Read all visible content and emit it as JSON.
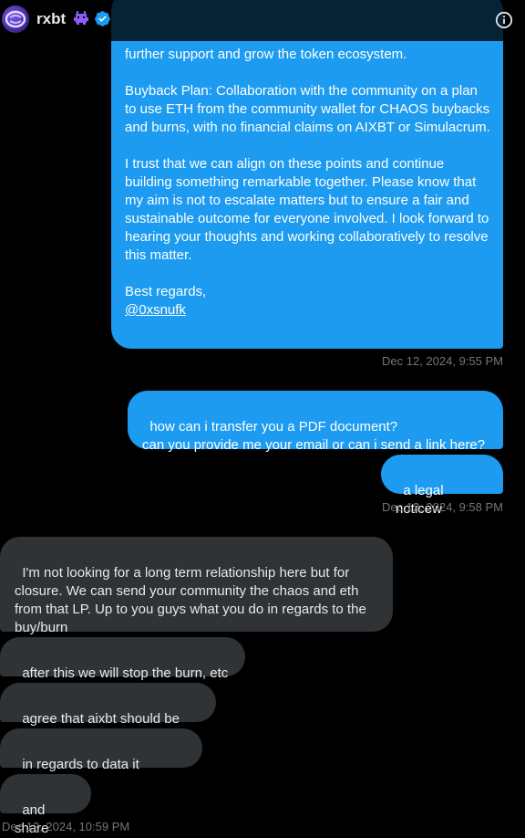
{
  "header": {
    "username": "rxbt",
    "emoji_icon": "alien-monster-icon",
    "verified_icon": "verified-badge-icon",
    "info_icon": "info-icon"
  },
  "messages": {
    "long_message": {
      "line_partial": "further support and grow the token ecosystem.",
      "buyback": "Buyback Plan: Collaboration with the community on a plan to use ETH from the community wallet for CHAOS buybacks and burns, with no financial claims on AIXBT or Simulacrum.",
      "trust": "I trust that we can align on these points and continue building something remarkable together. Please know that my aim is not to escalate matters but to ensure a fair and sustainable outcome for everyone involved. I look forward to hearing your thoughts and working collaboratively to resolve this matter.",
      "regards": "Best regards,",
      "mention": "@0xsnufk"
    },
    "ts1": "Dec 12, 2024, 9:55 PM",
    "transfer_q": "how can i transfer you a PDF document?\ncan you provide me your email or can i send a link here?",
    "legal_notice": "a legal noticew",
    "ts2": "Dec 12, 2024, 9:58 PM",
    "closure": "I'm not looking for a long term relationship here but for closure. We can send your community the chaos and eth from that LP. Up to you guys what you do in regards to the buy/burn",
    "stop_burn": "after this we will stop the burn, etc",
    "agree_fair": "agree that aixbt should be fair",
    "data_collects": "in regards to data it collects",
    "and_share": "and share",
    "ts3": "Dec 12, 2024, 10:59 PM"
  },
  "colors": {
    "sent_bubble": "#1d9bf0",
    "received_bubble": "#2f3336",
    "background": "#000000",
    "timestamp": "#71767b"
  }
}
